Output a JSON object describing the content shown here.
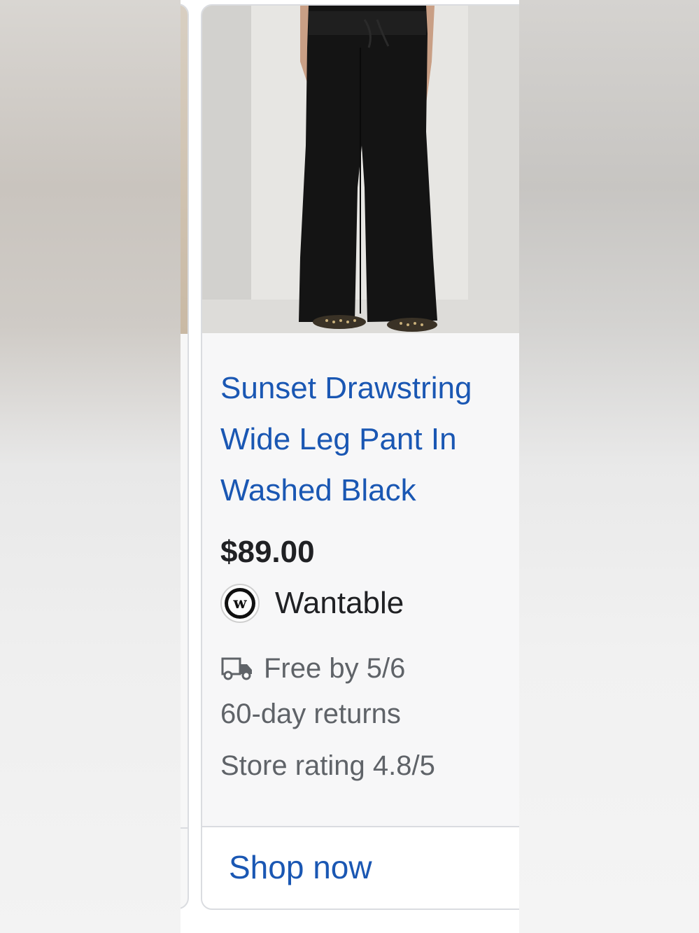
{
  "product": {
    "title": "Sunset Drawstring Wide Leg Pant In Washed Black",
    "price": "$89.00",
    "merchant": {
      "name": "Wantable",
      "logo_letter": "w"
    },
    "shipping": "Free by 5/6",
    "returns": "60-day returns",
    "store_rating": "Store rating 4.8/5",
    "cta_label": "Shop now"
  },
  "colors": {
    "link_blue": "#1a57b3",
    "text_dark": "#202124",
    "text_gray": "#5f6368",
    "card_bg": "#f7f7f8",
    "border": "#dadce0"
  },
  "icons": {
    "shipping": "truck-icon",
    "merchant": "wantable-logo-icon"
  }
}
